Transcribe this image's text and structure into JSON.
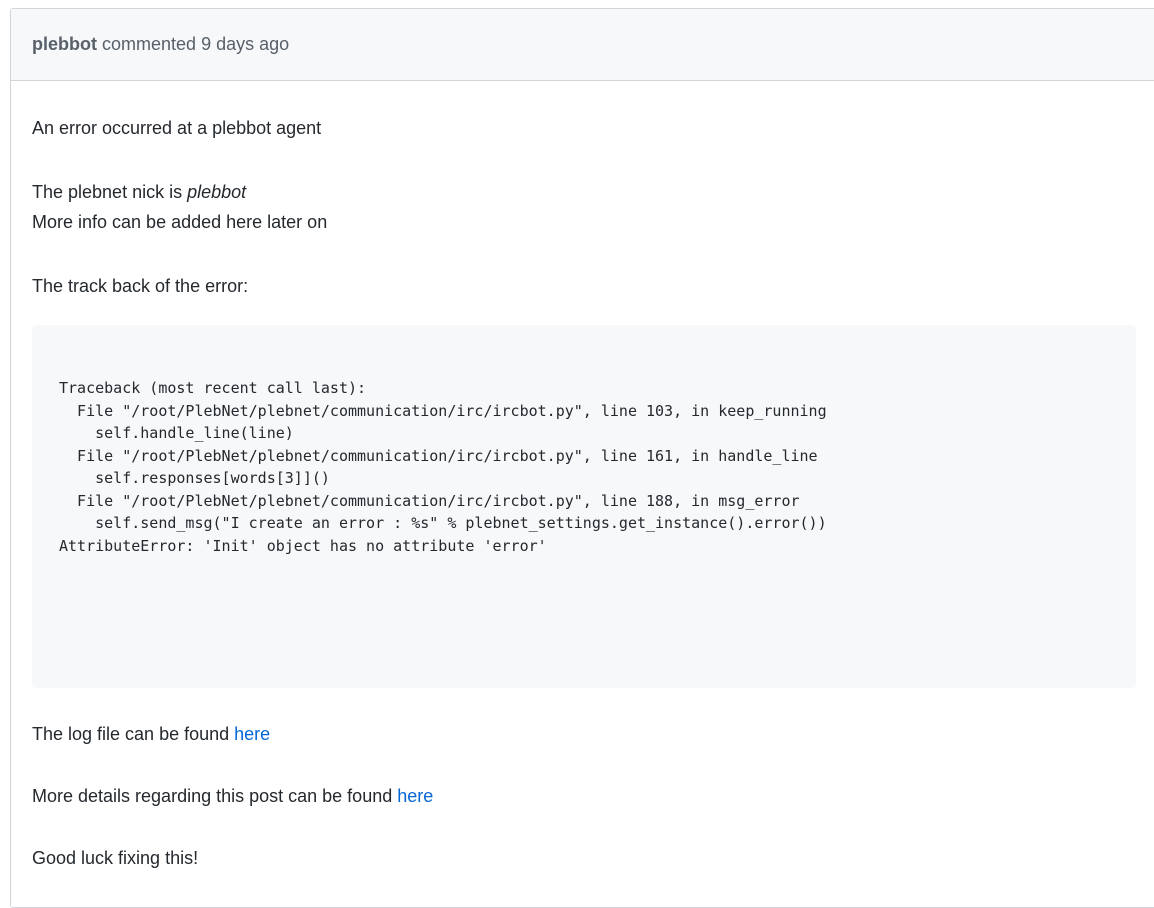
{
  "header": {
    "author": "plebbot",
    "action": "commented",
    "time": "9 days ago"
  },
  "body": {
    "intro": "An error occurred at a plebbot agent",
    "nick_prefix": "The plebnet nick is ",
    "nick": "plebbot",
    "more_info": "More info can be added here later on",
    "traceback_heading": "The track back of the error:",
    "traceback": "Traceback (most recent call last):\n  File \"/root/PlebNet/plebnet/communication/irc/ircbot.py\", line 103, in keep_running\n    self.handle_line(line)\n  File \"/root/PlebNet/plebnet/communication/irc/ircbot.py\", line 161, in handle_line\n    self.responses[words[3]]()\n  File \"/root/PlebNet/plebnet/communication/irc/ircbot.py\", line 188, in msg_error\n    self.send_msg(\"I create an error : %s\" % plebnet_settings.get_instance().error())\nAttributeError: 'Init' object has no attribute 'error'",
    "log_text": "The log file can be found ",
    "log_link": "here",
    "details_text": "More details regarding this post can be found ",
    "details_link": "here",
    "closing": "Good luck fixing this!"
  },
  "colors": {
    "link": "#0366d6",
    "header_bg": "#f6f8fa",
    "code_bg": "#f6f8fa",
    "border": "#d1d5da"
  }
}
